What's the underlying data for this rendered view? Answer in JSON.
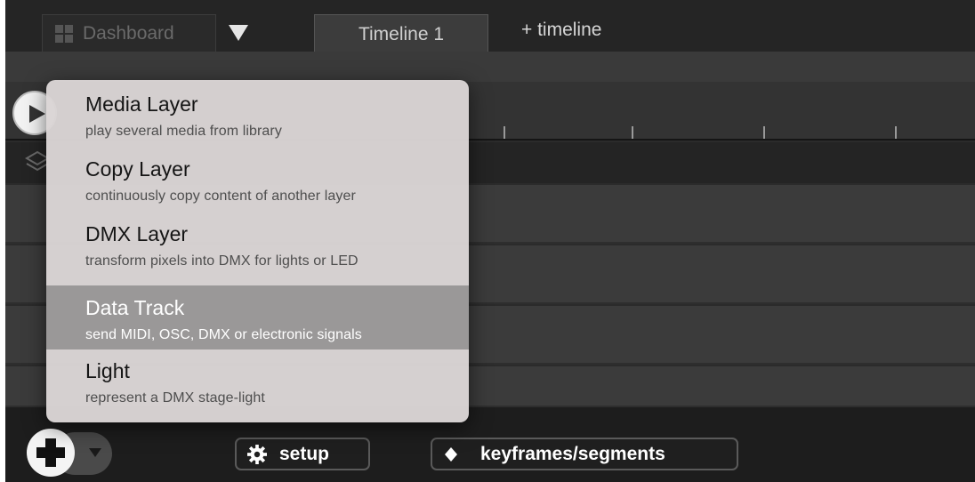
{
  "tabs": {
    "dashboard_label": "Dashboard",
    "active_label": "Timeline 1",
    "add_label": "+ timeline"
  },
  "menu": {
    "items": [
      {
        "title": "Media Layer",
        "description": "play several media from library"
      },
      {
        "title": "Copy Layer",
        "description": "continuously copy content of another layer"
      },
      {
        "title": "DMX Layer",
        "description": "transform pixels into DMX for lights or LED"
      },
      {
        "title": "Data Track",
        "description": "send MIDI, OSC, DMX or electronic signals",
        "highlighted": true
      },
      {
        "title": "Light",
        "description": "represent a DMX stage-light"
      }
    ]
  },
  "bottom_bar": {
    "setup_label": "setup",
    "keyframes_label": "keyframes/segments"
  },
  "icons": {
    "dashboard": "grid-icon",
    "dropdown": "triangle-down-icon",
    "play": "play-icon",
    "layers": "layers-icon",
    "add": "plus-icon",
    "setup": "gear-icon",
    "keyframes": "diamond-icon"
  },
  "colors": {
    "menu_background": "#dad5d5",
    "menu_highlight": "#9a9898",
    "app_background": "#2b2b2b"
  }
}
